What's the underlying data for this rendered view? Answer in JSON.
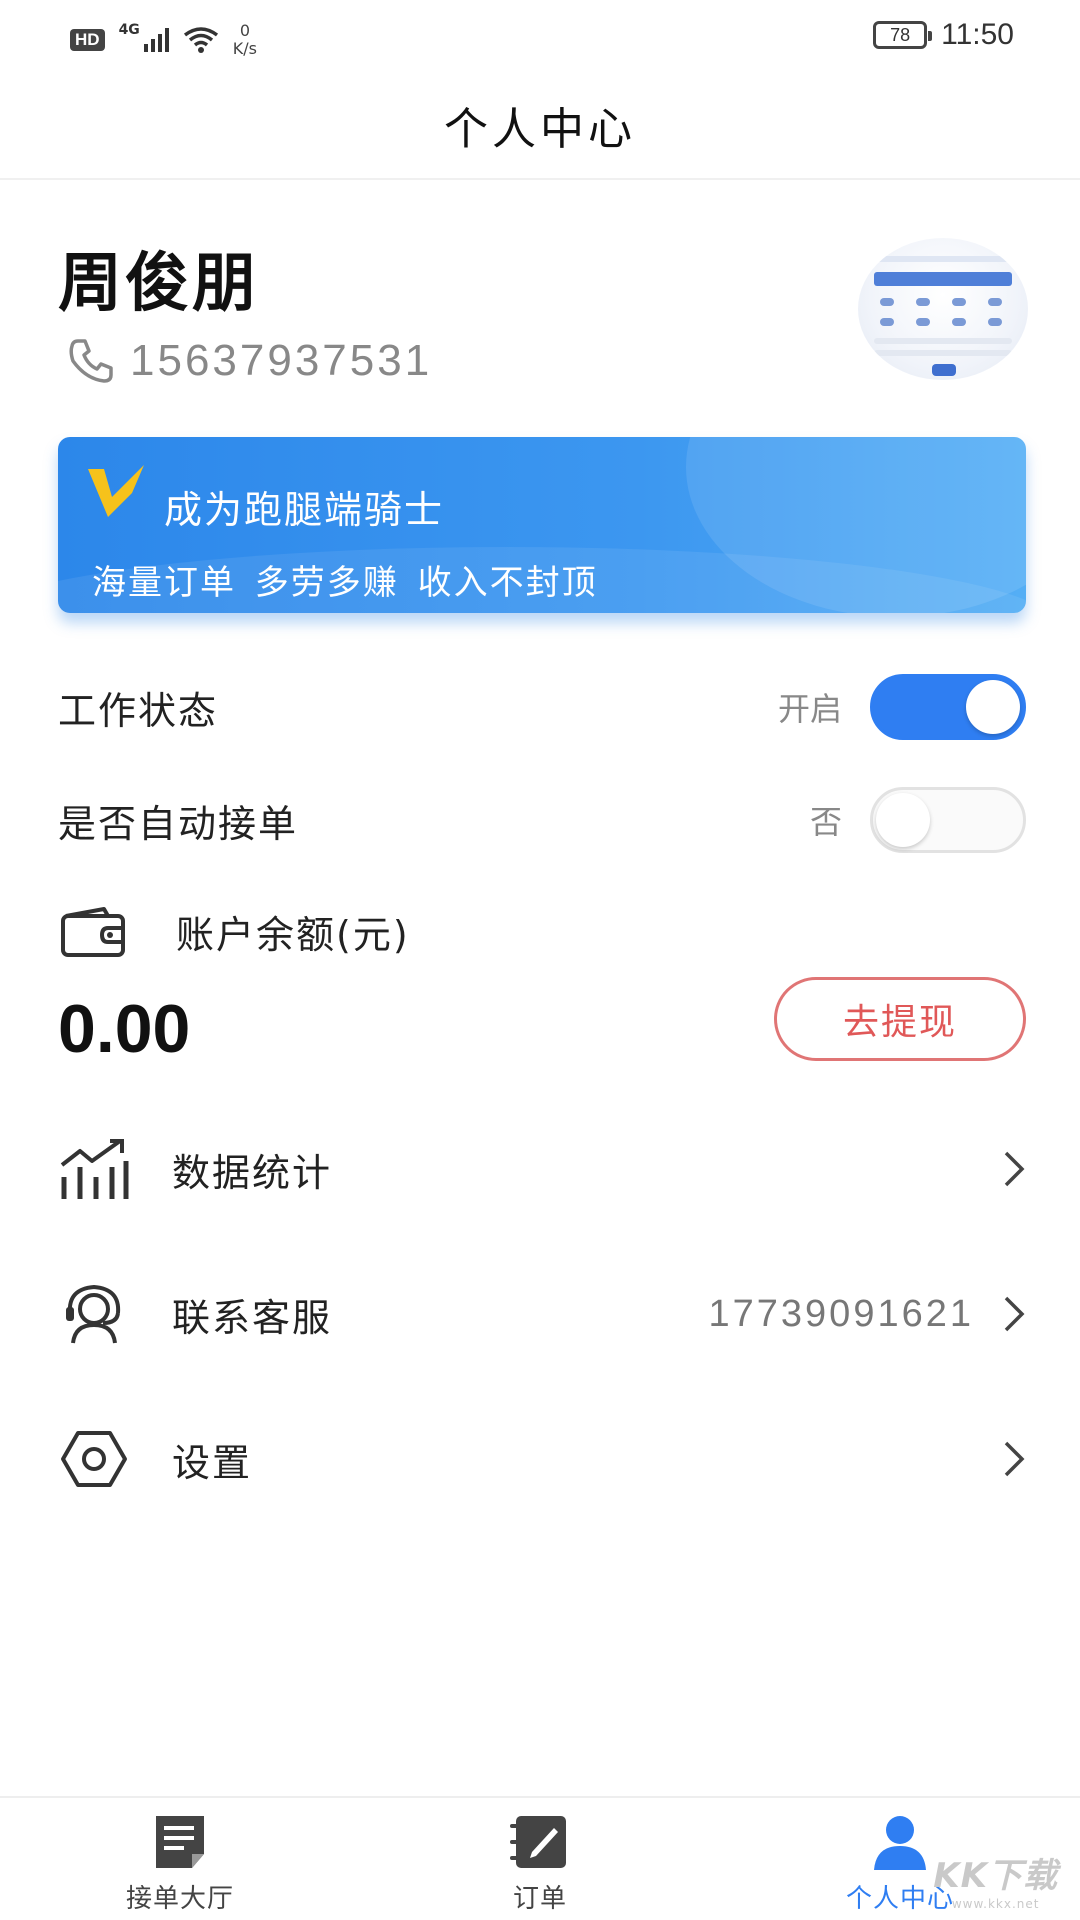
{
  "status_bar": {
    "hd": "HD",
    "network": "4G",
    "speed_value": "0",
    "speed_unit": "K/s",
    "battery": "78",
    "time": "11:50"
  },
  "header": {
    "title": "个人中心"
  },
  "profile": {
    "name": "周俊朋",
    "phone": "15637937531",
    "phone_icon": "phone-icon",
    "avatar": "avatar"
  },
  "banner": {
    "title": "成为跑腿端骑士",
    "subtitle": "海量订单 多劳多赚 收入不封顶",
    "logo_icon": "v-logo-icon"
  },
  "settings": {
    "work_status": {
      "label": "工作状态",
      "state": "开启",
      "on": true
    },
    "auto_accept": {
      "label": "是否自动接单",
      "state": "否",
      "on": false
    }
  },
  "balance": {
    "icon": "wallet-icon",
    "label": "账户余额(元)",
    "value": "0.00",
    "withdraw_label": "去提现"
  },
  "menu": {
    "stats": {
      "label": "数据统计",
      "icon": "chart-icon"
    },
    "support": {
      "label": "联系客服",
      "value": "17739091621",
      "icon": "headset-icon"
    },
    "settings": {
      "label": "设置",
      "icon": "hexagon-settings-icon"
    }
  },
  "bottom_nav": {
    "items": [
      {
        "label": "接单大厅",
        "icon": "document-icon",
        "active": false
      },
      {
        "label": "订单",
        "icon": "order-edit-icon",
        "active": false
      },
      {
        "label": "个人中心",
        "icon": "user-icon",
        "active": true
      }
    ]
  },
  "watermark": {
    "main": "KK下载",
    "sub": "www.kkx.net"
  },
  "colors": {
    "accent": "#2f7ef2",
    "banner_blue": "#3c97f0",
    "withdraw_red": "#e05858",
    "toggle_off_border": "#e2e2e2"
  }
}
